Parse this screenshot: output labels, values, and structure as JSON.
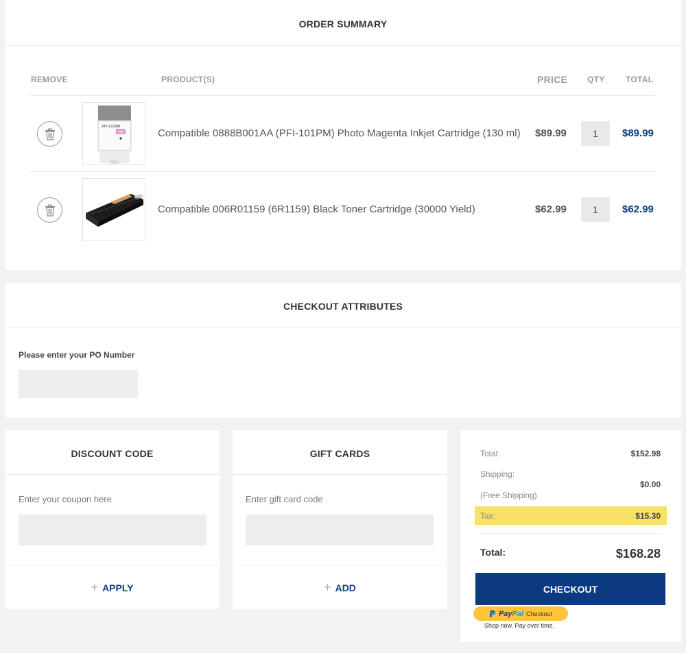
{
  "order_summary": {
    "title": "ORDER SUMMARY",
    "headers": {
      "remove": "REMOVE",
      "products": "PRODUCT(S)",
      "price": "PRICE",
      "qty": "QTY",
      "total": "TOTAL"
    },
    "items": [
      {
        "name": "Compatible 0888B001AA (PFI-101PM) Photo Magenta Inkjet Cartridge (130 ml)",
        "price": "$89.99",
        "qty": "1",
        "total": "$89.99",
        "thumb_label": "PFI-101PM",
        "thumb_badge": "PM"
      },
      {
        "name": "Compatible 006R01159 (6R1159) Black Toner Cartridge (30000 Yield)",
        "price": "$62.99",
        "qty": "1",
        "total": "$62.99"
      }
    ]
  },
  "checkout_attributes": {
    "title": "CHECKOUT ATTRIBUTES",
    "po_label": "Please enter your PO Number",
    "po_value": ""
  },
  "discount": {
    "title": "DISCOUNT CODE",
    "hint": "Enter your coupon here",
    "value": "",
    "button": "APPLY"
  },
  "gift_cards": {
    "title": "GIFT CARDS",
    "hint": "Enter gift card code",
    "value": "",
    "button": "ADD"
  },
  "totals": {
    "subtotal_label": "Total:",
    "subtotal_value": "$152.98",
    "shipping_label": "Shipping:",
    "shipping_note": "(Free Shipping)",
    "shipping_value": "$0.00",
    "tax_label": "Tax:",
    "tax_value": "$15.30",
    "grand_label": "Total:",
    "grand_value": "$168.28",
    "checkout_button": "CHECKOUT",
    "paypal": {
      "pay": "Pay",
      "pal": "Pal",
      "word": "Checkout",
      "tagline": "Shop now. Pay over time."
    }
  },
  "colors": {
    "accent": "#0c3a80",
    "price_total": "#0f3c7e",
    "tax_highlight": "#f7e166",
    "paypal": "#ffc439"
  },
  "icons": {
    "remove": "trash-icon",
    "add": "plus-icon"
  }
}
